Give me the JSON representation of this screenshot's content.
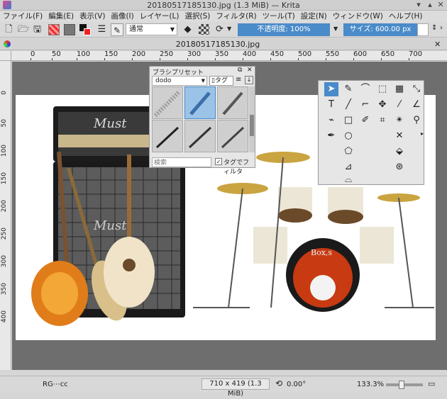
{
  "window": {
    "title": "20180517185130.jpg (1.3 MiB)  — Krita",
    "min": "▾",
    "max": "▴",
    "close": "✕"
  },
  "menu": [
    "ファイル(F)",
    "編集(E)",
    "表示(V)",
    "画像(I)",
    "レイヤー(L)",
    "選択(S)",
    "フィルタ(R)",
    "ツール(T)",
    "設定(N)",
    "ウィンドウ(W)",
    "ヘルプ(H)"
  ],
  "toolbar": {
    "blend_mode": "通常",
    "opacity": "不透明度: 100%",
    "size": "サイズ: 600.00 px"
  },
  "tab": {
    "filename": "20180517185130.jpg",
    "close": "✕"
  },
  "hruler": [
    "0",
    "50",
    "100",
    "150",
    "200",
    "250",
    "300",
    "350",
    "400",
    "450",
    "500",
    "550",
    "600",
    "650",
    "700"
  ],
  "vruler": [
    "0",
    "50",
    "100",
    "150",
    "200",
    "250",
    "300",
    "350",
    "400"
  ],
  "brush_presets": {
    "title": "ブラシプリセット",
    "preset_select": "dodo",
    "tag_label": "タグ",
    "search_placeholder": "検索",
    "filter_by_tag": "タグでフィルタ"
  },
  "canvas_text": {
    "amp1": "Must",
    "amp2": "Must",
    "drum_brand": "Box,s"
  },
  "statusbar": {
    "color_model": "RG⋯cc",
    "image_size": "710 x 419 (1.3 MiB)",
    "rotation": "0.00°",
    "zoom": "133.3%"
  },
  "colors": {
    "accent_blue": "#4a8bc9",
    "canvas_bg": "#6e6e6e"
  }
}
